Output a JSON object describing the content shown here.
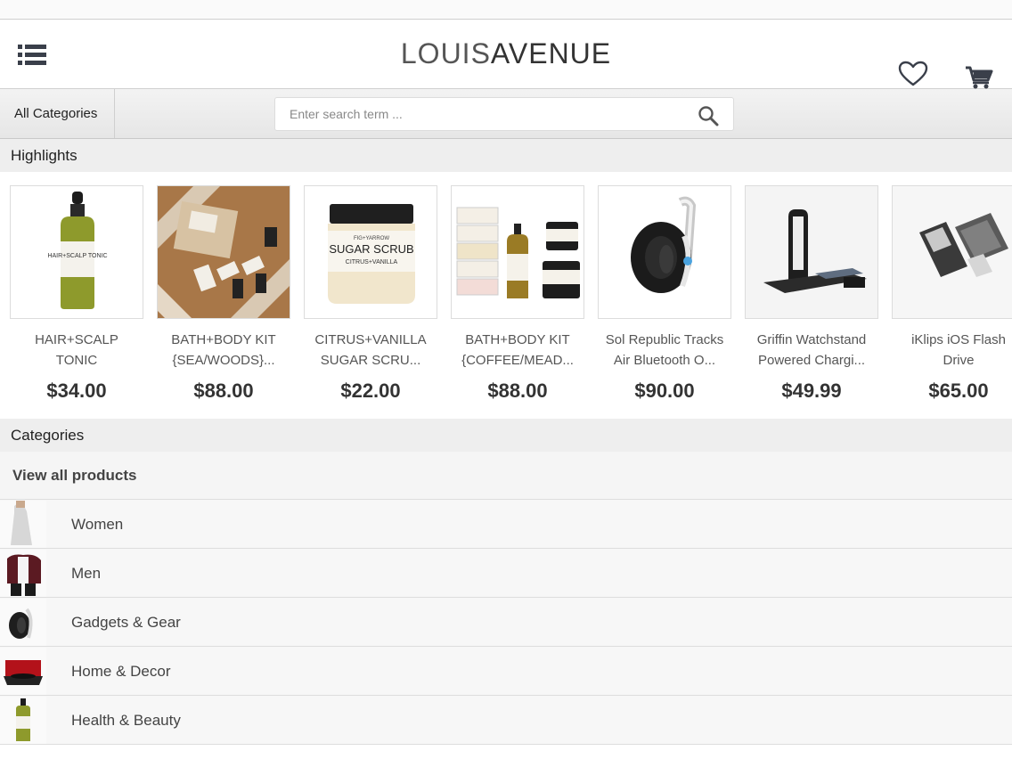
{
  "header": {
    "logo_light": "LOUIS",
    "logo_bold": "AVENUE"
  },
  "search": {
    "category_label": "All Categories",
    "placeholder": "Enter search term ..."
  },
  "highlights": {
    "title": "Highlights",
    "items": [
      {
        "name_1": "HAIR+SCALP",
        "name_2": "TONIC",
        "price": "$34.00"
      },
      {
        "name_1": "BATH+BODY KIT",
        "name_2": "{SEA/WOODS}...",
        "price": "$88.00"
      },
      {
        "name_1": "CITRUS+VANILLA",
        "name_2": "SUGAR SCRU...",
        "price": "$22.00"
      },
      {
        "name_1": "BATH+BODY KIT",
        "name_2": "{COFFEE/MEAD...",
        "price": "$88.00"
      },
      {
        "name_1": "Sol Republic Tracks",
        "name_2": "Air Bluetooth O...",
        "price": "$90.00"
      },
      {
        "name_1": "Griffin Watchstand",
        "name_2": "Powered Chargi...",
        "price": "$49.99"
      },
      {
        "name_1": "iKlips iOS Flash",
        "name_2": "Drive",
        "price": "$65.00"
      }
    ]
  },
  "product_thumbs": {
    "sugar_scrub_brand": "FIG+YARROW",
    "sugar_scrub_title": "SUGAR SCRUB",
    "sugar_scrub_sub": "CITRUS+VANILLA",
    "tonic_label": "HAIR+SCALP TONIC"
  },
  "categories": {
    "title": "Categories",
    "view_all": "View all products",
    "items": [
      {
        "label": "Women"
      },
      {
        "label": "Men"
      },
      {
        "label": "Gadgets & Gear"
      },
      {
        "label": "Home & Decor"
      },
      {
        "label": "Health & Beauty"
      }
    ]
  },
  "colors": {
    "icon": "#3a3f4a",
    "price": "#333333",
    "section_bg": "#eeeeee"
  }
}
